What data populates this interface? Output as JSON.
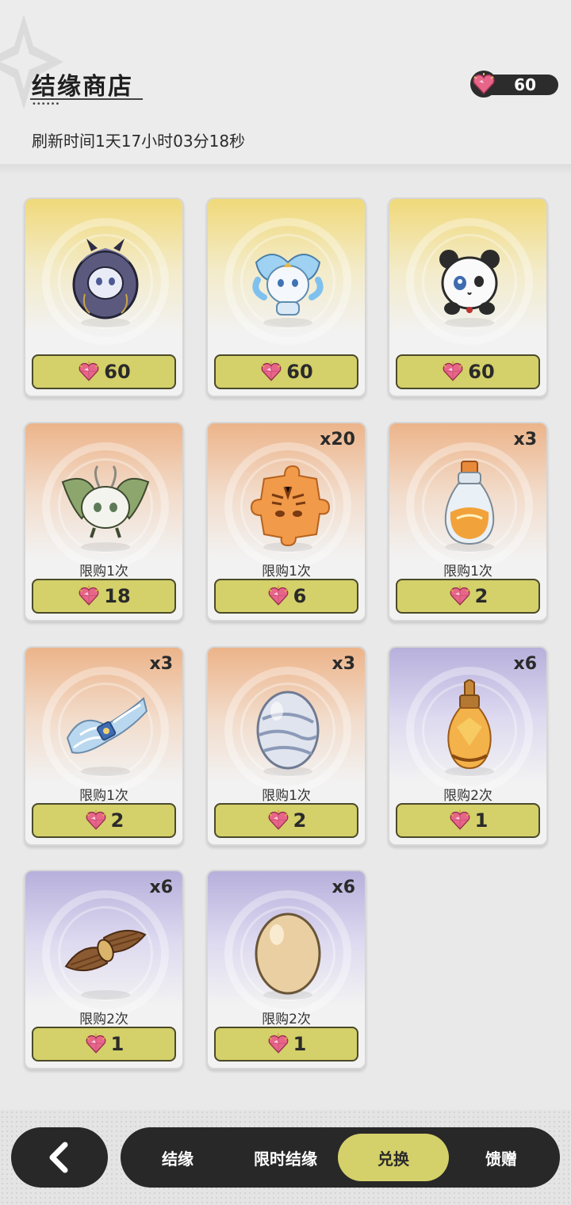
{
  "header": {
    "title": "结缘商店",
    "refresh_text": "刷新时间1天17小时03分18秒",
    "currency_amount": "60",
    "title_dots": "••••••"
  },
  "items": [
    {
      "name": "dark-hooded-spirit",
      "theme": "gold",
      "price": "60",
      "qty": "",
      "limit": ""
    },
    {
      "name": "ice-dragon-spirit",
      "theme": "gold",
      "price": "60",
      "qty": "",
      "limit": ""
    },
    {
      "name": "panda-spirit",
      "theme": "gold",
      "price": "60",
      "qty": "",
      "limit": ""
    },
    {
      "name": "moth-spirit",
      "theme": "orange",
      "price": "18",
      "qty": "",
      "limit": "限购1次"
    },
    {
      "name": "tiger-puzzle-piece",
      "theme": "orange",
      "price": "6",
      "qty": "x20",
      "limit": "限购1次"
    },
    {
      "name": "fire-potion",
      "theme": "orange",
      "price": "2",
      "qty": "x3",
      "limit": "限购1次"
    },
    {
      "name": "cloth-scroll",
      "theme": "orange",
      "price": "2",
      "qty": "x3",
      "limit": "限购1次"
    },
    {
      "name": "silver-egg",
      "theme": "orange",
      "price": "2",
      "qty": "x3",
      "limit": "限购1次"
    },
    {
      "name": "amber-vial",
      "theme": "purple",
      "price": "1",
      "qty": "x6",
      "limit": "限购2次"
    },
    {
      "name": "straw-bundle",
      "theme": "purple",
      "price": "1",
      "qty": "x6",
      "limit": "限购2次"
    },
    {
      "name": "plain-egg",
      "theme": "purple",
      "price": "1",
      "qty": "x6",
      "limit": "限购2次"
    }
  ],
  "nav": {
    "tabs": [
      {
        "label": "结缘",
        "active": false
      },
      {
        "label": "限时结缘",
        "active": false
      },
      {
        "label": "兑换",
        "active": true
      },
      {
        "label": "馈赠",
        "active": false
      }
    ]
  },
  "colors": {
    "accent": "#d4d06a",
    "dark": "#282828",
    "gem": "#e8658a"
  },
  "icons": {
    "currency": "heart-gem-icon",
    "back": "back-arrow-icon"
  }
}
